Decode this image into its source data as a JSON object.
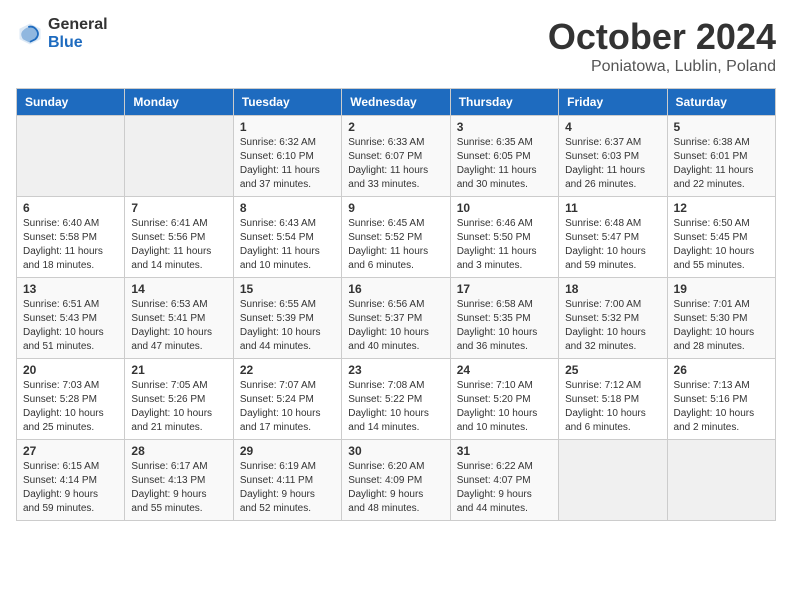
{
  "header": {
    "logo": {
      "general": "General",
      "blue": "Blue"
    },
    "title": "October 2024",
    "location": "Poniatowa, Lublin, Poland"
  },
  "calendar": {
    "days_of_week": [
      "Sunday",
      "Monday",
      "Tuesday",
      "Wednesday",
      "Thursday",
      "Friday",
      "Saturday"
    ],
    "weeks": [
      [
        {
          "day": "",
          "info": ""
        },
        {
          "day": "",
          "info": ""
        },
        {
          "day": "1",
          "info": "Sunrise: 6:32 AM\nSunset: 6:10 PM\nDaylight: 11 hours\nand 37 minutes."
        },
        {
          "day": "2",
          "info": "Sunrise: 6:33 AM\nSunset: 6:07 PM\nDaylight: 11 hours\nand 33 minutes."
        },
        {
          "day": "3",
          "info": "Sunrise: 6:35 AM\nSunset: 6:05 PM\nDaylight: 11 hours\nand 30 minutes."
        },
        {
          "day": "4",
          "info": "Sunrise: 6:37 AM\nSunset: 6:03 PM\nDaylight: 11 hours\nand 26 minutes."
        },
        {
          "day": "5",
          "info": "Sunrise: 6:38 AM\nSunset: 6:01 PM\nDaylight: 11 hours\nand 22 minutes."
        }
      ],
      [
        {
          "day": "6",
          "info": "Sunrise: 6:40 AM\nSunset: 5:58 PM\nDaylight: 11 hours\nand 18 minutes."
        },
        {
          "day": "7",
          "info": "Sunrise: 6:41 AM\nSunset: 5:56 PM\nDaylight: 11 hours\nand 14 minutes."
        },
        {
          "day": "8",
          "info": "Sunrise: 6:43 AM\nSunset: 5:54 PM\nDaylight: 11 hours\nand 10 minutes."
        },
        {
          "day": "9",
          "info": "Sunrise: 6:45 AM\nSunset: 5:52 PM\nDaylight: 11 hours\nand 6 minutes."
        },
        {
          "day": "10",
          "info": "Sunrise: 6:46 AM\nSunset: 5:50 PM\nDaylight: 11 hours\nand 3 minutes."
        },
        {
          "day": "11",
          "info": "Sunrise: 6:48 AM\nSunset: 5:47 PM\nDaylight: 10 hours\nand 59 minutes."
        },
        {
          "day": "12",
          "info": "Sunrise: 6:50 AM\nSunset: 5:45 PM\nDaylight: 10 hours\nand 55 minutes."
        }
      ],
      [
        {
          "day": "13",
          "info": "Sunrise: 6:51 AM\nSunset: 5:43 PM\nDaylight: 10 hours\nand 51 minutes."
        },
        {
          "day": "14",
          "info": "Sunrise: 6:53 AM\nSunset: 5:41 PM\nDaylight: 10 hours\nand 47 minutes."
        },
        {
          "day": "15",
          "info": "Sunrise: 6:55 AM\nSunset: 5:39 PM\nDaylight: 10 hours\nand 44 minutes."
        },
        {
          "day": "16",
          "info": "Sunrise: 6:56 AM\nSunset: 5:37 PM\nDaylight: 10 hours\nand 40 minutes."
        },
        {
          "day": "17",
          "info": "Sunrise: 6:58 AM\nSunset: 5:35 PM\nDaylight: 10 hours\nand 36 minutes."
        },
        {
          "day": "18",
          "info": "Sunrise: 7:00 AM\nSunset: 5:32 PM\nDaylight: 10 hours\nand 32 minutes."
        },
        {
          "day": "19",
          "info": "Sunrise: 7:01 AM\nSunset: 5:30 PM\nDaylight: 10 hours\nand 28 minutes."
        }
      ],
      [
        {
          "day": "20",
          "info": "Sunrise: 7:03 AM\nSunset: 5:28 PM\nDaylight: 10 hours\nand 25 minutes."
        },
        {
          "day": "21",
          "info": "Sunrise: 7:05 AM\nSunset: 5:26 PM\nDaylight: 10 hours\nand 21 minutes."
        },
        {
          "day": "22",
          "info": "Sunrise: 7:07 AM\nSunset: 5:24 PM\nDaylight: 10 hours\nand 17 minutes."
        },
        {
          "day": "23",
          "info": "Sunrise: 7:08 AM\nSunset: 5:22 PM\nDaylight: 10 hours\nand 14 minutes."
        },
        {
          "day": "24",
          "info": "Sunrise: 7:10 AM\nSunset: 5:20 PM\nDaylight: 10 hours\nand 10 minutes."
        },
        {
          "day": "25",
          "info": "Sunrise: 7:12 AM\nSunset: 5:18 PM\nDaylight: 10 hours\nand 6 minutes."
        },
        {
          "day": "26",
          "info": "Sunrise: 7:13 AM\nSunset: 5:16 PM\nDaylight: 10 hours\nand 2 minutes."
        }
      ],
      [
        {
          "day": "27",
          "info": "Sunrise: 6:15 AM\nSunset: 4:14 PM\nDaylight: 9 hours\nand 59 minutes."
        },
        {
          "day": "28",
          "info": "Sunrise: 6:17 AM\nSunset: 4:13 PM\nDaylight: 9 hours\nand 55 minutes."
        },
        {
          "day": "29",
          "info": "Sunrise: 6:19 AM\nSunset: 4:11 PM\nDaylight: 9 hours\nand 52 minutes."
        },
        {
          "day": "30",
          "info": "Sunrise: 6:20 AM\nSunset: 4:09 PM\nDaylight: 9 hours\nand 48 minutes."
        },
        {
          "day": "31",
          "info": "Sunrise: 6:22 AM\nSunset: 4:07 PM\nDaylight: 9 hours\nand 44 minutes."
        },
        {
          "day": "",
          "info": ""
        },
        {
          "day": "",
          "info": ""
        }
      ]
    ]
  }
}
